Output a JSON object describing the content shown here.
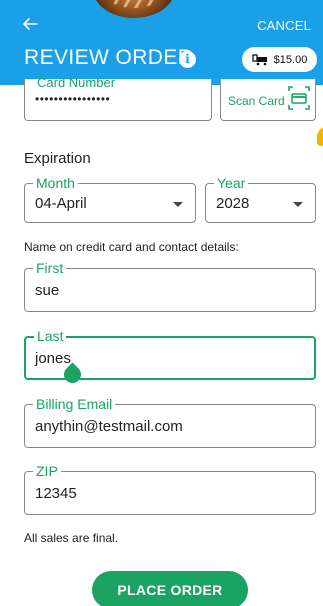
{
  "header": {
    "cancel_label": "CANCEL",
    "title": "REVIEW ORDER",
    "info_glyph": "i",
    "cart_total": "$15.00",
    "icons": [
      "back-arrow-icon",
      "info-icon",
      "cart-icon"
    ]
  },
  "card": {
    "number_label": "Card Number",
    "number_value": "••••••••••••••••",
    "scan_label": "Scan Card"
  },
  "expiration": {
    "section_label": "Expiration",
    "month_label": "Month",
    "month_value": "04-April",
    "year_label": "Year",
    "year_value": "2028"
  },
  "contact": {
    "section_label": "Name on credit card and contact details:",
    "first_label": "First",
    "first_value": "sue",
    "last_label": "Last",
    "last_value": "jones",
    "email_label": "Billing Email",
    "email_value": "anythin@testmail.com",
    "zip_label": "ZIP",
    "zip_value": "12345"
  },
  "footer": {
    "note": "All sales are final.",
    "place_order_label": "PLACE ORDER"
  },
  "colors": {
    "header_bg": "#1aa0e8",
    "accent_green": "#1aa361"
  }
}
